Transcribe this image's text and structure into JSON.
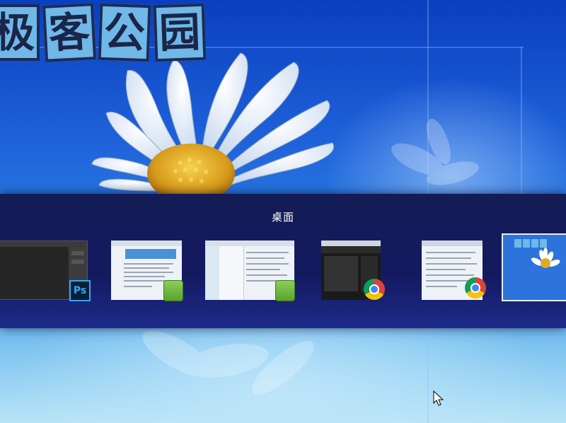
{
  "wallpaper": {
    "logo_chars": [
      "极",
      "客",
      "公",
      "园"
    ]
  },
  "switcher": {
    "title": "桌面",
    "items": [
      {
        "name": "photoshop-window",
        "badge_icon": "photoshop-icon",
        "badge_text": "Ps"
      },
      {
        "name": "evernote-window-1",
        "badge_icon": "evernote-icon"
      },
      {
        "name": "evernote-window-2",
        "badge_icon": "evernote-icon"
      },
      {
        "name": "chrome-window-1",
        "badge_icon": "chrome-icon"
      },
      {
        "name": "chrome-window-2",
        "badge_icon": "chrome-icon"
      },
      {
        "name": "desktop-window",
        "badge_icon": "desktop-wallpaper-thumbnail",
        "selected": true
      }
    ]
  },
  "colors": {
    "switcher_bg": "#141a60",
    "selection_border": "#e9eefb",
    "photoshop_accent": "#31a8ff",
    "evernote_green": "#5aa22e"
  }
}
